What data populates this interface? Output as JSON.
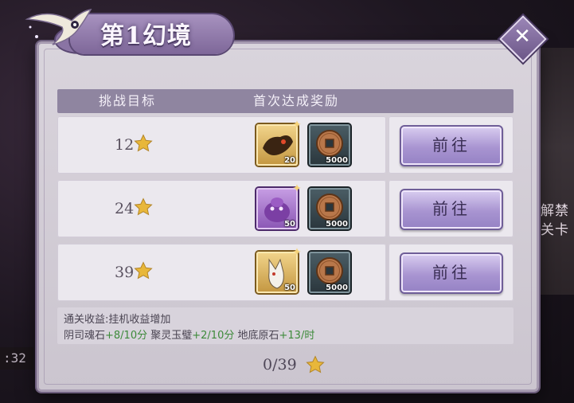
{
  "title": "第1幻境",
  "header": {
    "target_col": "挑战目标",
    "reward_col": "首次达成奖励"
  },
  "rows": [
    {
      "target": "12",
      "rewards": [
        {
          "icon": "gold-beast-item-icon",
          "qty": "20",
          "frame": "gold"
        },
        {
          "icon": "copper-coin-icon",
          "qty": "5000",
          "frame": "teal"
        }
      ],
      "button": "前往"
    },
    {
      "target": "24",
      "rewards": [
        {
          "icon": "purple-blob-item-icon",
          "qty": "50",
          "frame": "purple"
        },
        {
          "icon": "copper-coin-icon",
          "qty": "5000",
          "frame": "teal"
        }
      ],
      "button": "前往"
    },
    {
      "target": "39",
      "rewards": [
        {
          "icon": "white-fox-item-icon",
          "qty": "50",
          "frame": "gold"
        },
        {
          "icon": "copper-coin-icon",
          "qty": "5000",
          "frame": "teal"
        }
      ],
      "button": "前往"
    }
  ],
  "info": {
    "line1": "通关收益:挂机收益增加",
    "stat1_name": "阴司魂石",
    "stat1_value": "+8/10分",
    "stat2_name": "聚灵玉璧",
    "stat2_value": "+2/10分",
    "stat3_name": "地底原石",
    "stat3_value": "+13/时"
  },
  "progress": "0/39",
  "background": {
    "right_text_1": "解禁",
    "right_text_2": "置关卡",
    "left_time": ":32"
  },
  "colors": {
    "accent_purple": "#8f85a0",
    "green_value": "#3d8a3a",
    "star_gold": "#e8b73a"
  }
}
